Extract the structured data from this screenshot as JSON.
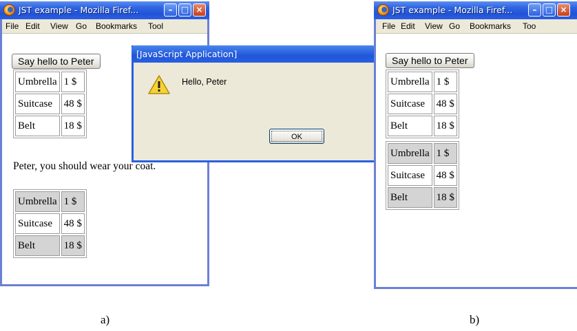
{
  "window_a": {
    "title": "JST example - Mozilla Firef...",
    "menu": [
      "File",
      "Edit",
      "View",
      "Go",
      "Bookmarks",
      "Tool"
    ],
    "button_label": "Say hello to Peter",
    "table1": [
      {
        "item": "Umbrella",
        "price": "1 $"
      },
      {
        "item": "Suitcase",
        "price": "48 $"
      },
      {
        "item": "Belt",
        "price": "18 $"
      }
    ],
    "message": "Peter, you should wear your coat.",
    "table2": [
      {
        "item": "Umbrella",
        "price": "1 $"
      },
      {
        "item": "Suitcase",
        "price": "48 $"
      },
      {
        "item": "Belt",
        "price": "18 $"
      }
    ]
  },
  "dialog": {
    "title": "[JavaScript Application]",
    "message": "Hello, Peter",
    "ok_label": "OK",
    "icon": "warning-icon"
  },
  "window_b": {
    "title": "JST example - Mozilla Firef...",
    "menu": [
      "File",
      "Edit",
      "View",
      "Go",
      "Bookmarks",
      "Too"
    ],
    "button_label": "Say hello to Peter",
    "table1": [
      {
        "item": "Umbrella",
        "price": "1 $"
      },
      {
        "item": "Suitcase",
        "price": "48 $"
      },
      {
        "item": "Belt",
        "price": "18 $"
      }
    ],
    "table2": [
      {
        "item": "Umbrella",
        "price": "1 $"
      },
      {
        "item": "Suitcase",
        "price": "48 $"
      },
      {
        "item": "Belt",
        "price": "18 $"
      }
    ]
  },
  "captions": {
    "a": "a)",
    "b": "b)"
  },
  "colors": {
    "titlebar": "#2253d6",
    "window_border": "#6b7fd6",
    "highlight_row": "#d4d4d4",
    "chrome": "#ece9d8"
  }
}
